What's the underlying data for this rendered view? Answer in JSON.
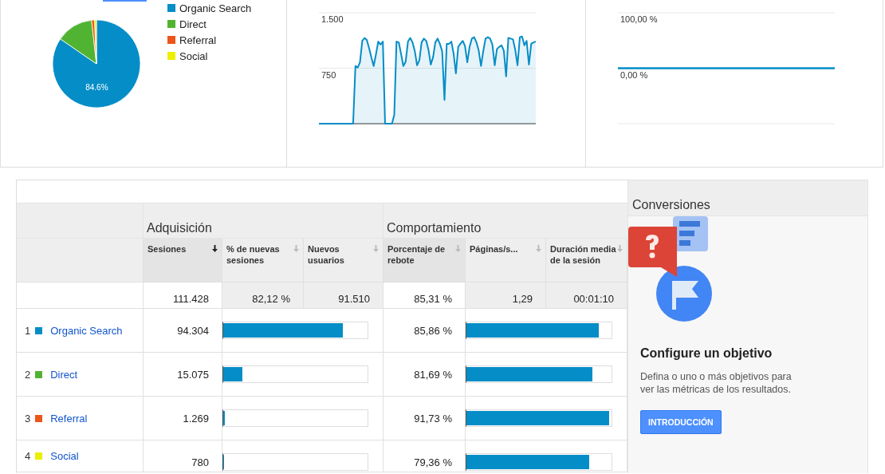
{
  "top_tabs": [
    {
      "selected": true
    }
  ],
  "pie": {
    "legend": [
      {
        "color": "#058dc7"
      },
      {
        "color": "#50b432"
      },
      {
        "color": "#ed561b"
      },
      {
        "color": "#edef00"
      }
    ],
    "chart_data": {
      "type": "pie",
      "categories": [
        "Organic Search",
        "Direct",
        "Referral",
        "Social"
      ],
      "values": [
        84.6,
        13.6,
        1.1,
        0.7
      ],
      "value_labels": [
        "84.6%",
        null,
        null,
        null
      ]
    }
  },
  "sessions_chart": {
    "chart_data": {
      "type": "area",
      "ylim": [
        0,
        1500
      ],
      "yticks": [
        {
          "value": 750,
          "label": "750"
        },
        {
          "value": 1500,
          "label": "1.500"
        }
      ],
      "series": [
        {
          "color": "#058dc7",
          "values": [
            0,
            0,
            0,
            0,
            0,
            0,
            0,
            0,
            0,
            0,
            0,
            0,
            0,
            0,
            0,
            0,
            780,
            760,
            830,
            1120,
            1160,
            1130,
            1020,
            890,
            780,
            940,
            1110,
            1070,
            1110,
            0,
            0,
            0,
            0,
            120,
            1110,
            1100,
            940,
            780,
            840,
            1110,
            1160,
            1100,
            980,
            790,
            860,
            1100,
            1150,
            1120,
            1000,
            800,
            900,
            1100,
            1150,
            1080,
            980,
            320,
            1080,
            1080,
            1110,
            950,
            680,
            1040,
            1080,
            1120,
            1050,
            830,
            1040,
            1150,
            1170,
            1100,
            990,
            780,
            980,
            1150,
            1170,
            1150,
            1070,
            790,
            1010,
            1040,
            1060,
            990,
            640,
            1160,
            1150,
            1140,
            1000,
            790,
            1170,
            1180,
            1060,
            1120,
            800,
            1080,
            1100,
            1110
          ]
        }
      ]
    }
  },
  "conversion_chart": {
    "chart_data": {
      "type": "line",
      "ylim": [
        -100,
        100
      ],
      "yticks": [
        {
          "value": 0,
          "label": "0,00 %"
        },
        {
          "value": 100,
          "label": "100,00 %"
        }
      ],
      "series": [
        {
          "color": "#058dc7",
          "values": [
            0,
            0,
            0,
            0,
            0,
            0,
            0,
            0,
            0,
            0
          ]
        }
      ]
    }
  },
  "table": {
    "groups": [
      "Adquisición",
      "Comportamiento"
    ],
    "columns": [
      {
        "label": "Sesiones",
        "sorted": true
      },
      {
        "label": "% de nuevas sesiones",
        "sorted": false
      },
      {
        "label": "Nuevos usuarios",
        "sorted": false
      },
      {
        "label": "Porcentaje de rebote",
        "sorted": false
      },
      {
        "label": "Páginas/s...",
        "sorted": false
      },
      {
        "label": "Duración media de la sesión",
        "sorted": false
      }
    ],
    "totals": [
      "111.428",
      "82,12 %",
      "91.510",
      "85,31 %",
      "1,29",
      "00:01:10"
    ],
    "rows": [
      {
        "index": "1",
        "name": "Organic Search",
        "color": "#058dc7",
        "sessions": {
          "value": "94.304",
          "level": 0.84
        },
        "bounce": {
          "value": "85,86 %",
          "level": 0.93
        }
      },
      {
        "index": "2",
        "name": "Direct",
        "color": "#50b432",
        "sessions": {
          "value": "15.075",
          "level": 0.135
        },
        "bounce": {
          "value": "81,69 %",
          "level": 0.885
        }
      },
      {
        "index": "3",
        "name": "Referral",
        "color": "#ed561b",
        "sessions": {
          "value": "1.269",
          "level": 0.012
        },
        "bounce": {
          "value": "91,73 %",
          "level": 1
        }
      },
      {
        "index": "4",
        "name": "Social",
        "color": "#edef00",
        "sessions": {
          "value": "780",
          "level": 0.007
        },
        "bounce": {
          "value": "79,36 %",
          "level": 0.86
        }
      }
    ]
  },
  "conversions": {
    "title": "Conversiones",
    "heading": "Configure un objetivo",
    "text": "Defina o uno o más objetivos para ver las métricas de los resultados.",
    "button": "INTRODUCCIÓN"
  }
}
